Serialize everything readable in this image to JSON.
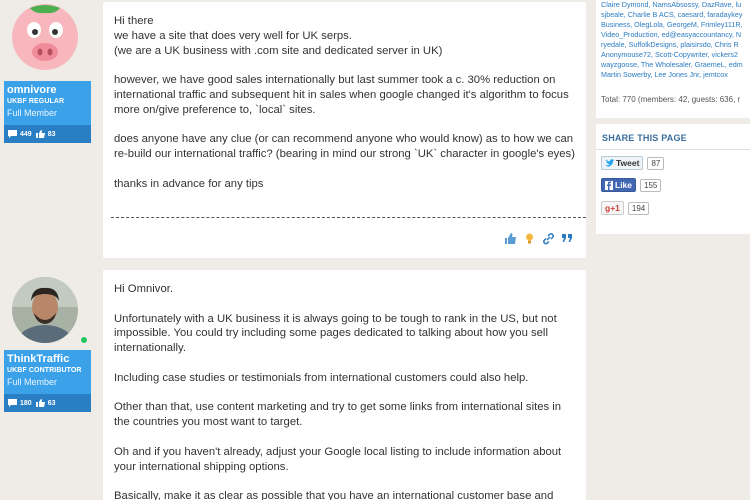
{
  "posts": [
    {
      "username": "omnivore",
      "user_title": "UKBF REGULAR",
      "user_group": "Full Member",
      "messages_count": "449",
      "likes_count": "83",
      "paragraphs": [
        "Hi there\nwe have a site that does very well for UK serps.\n(we are a UK business with .com site and dedicated server in UK)",
        "however, we have good sales internationally but last summer took a c. 30% reduction on international traffic and subsequent hit in sales when google changed it's algorithm to focus more on/give preference to, `local` sites.",
        "does anyone have any clue (or can recommend anyone who would know) as to how we can re-build our international traffic? (bearing in mind our strong `UK` character in google's eyes)",
        "thanks in advance for any tips"
      ]
    },
    {
      "username": "ThinkTraffic",
      "user_title": "UKBF CONTRIBUTOR",
      "user_group": "Full Member",
      "messages_count": "180",
      "likes_count": "63",
      "paragraphs": [
        "Hi Omnivor.",
        "Unfortunately with a UK business it is always going to be tough to rank in the US, but not impossible. You could try including some pages dedicated to talking about how you sell internationally.",
        "Including case studies or testimonials from international customers could also help.",
        "Other than that, use content marketing and try to get some links from international sites in the countries you most want to target.",
        "Oh and if you haven't already, adjust your Google local listing to include information about your international shipping options.",
        "Basically, make it as clear as possible that you have an international customer base and"
      ]
    }
  ],
  "sidebar": {
    "online_names": [
      "Claire Dymond, NamsAbsossy, DazRave, lu",
      "sjbeale, Charlie B ACS, caesard, faradaykey",
      "Business, OlegLola, GeorgeM, Frimley111R,",
      "Video_Production, ed@easyaccountancy, N",
      "ryedale, SuffolkDesigns, plaisirsdo, Chris R",
      "Anonymouse72, Scott-Copywriter, vickers2",
      "wayzgoose, The Wholesaler, GraemeL, edm",
      "Martin Sowerby, Lee Jones Jnr, jemtcox"
    ],
    "online_total": "Total: 770 (members: 42, guests: 636, r",
    "share_title": "SHARE THIS PAGE",
    "tweet_label": "Tweet",
    "tweet_count": "87",
    "like_label": "Like",
    "like_count": "155",
    "gplus_label": "g+1",
    "gplus_count": "194"
  },
  "colors": {
    "page_bg": "#efebe7",
    "user_card": "#3ba2ea",
    "user_stats": "#2a7ec4",
    "link": "#2b7bc2"
  },
  "icons": [
    "messages-icon",
    "likes-icon",
    "thumbs-up-icon",
    "bulb-icon",
    "link-icon",
    "quote-icon",
    "twitter-icon",
    "facebook-icon"
  ]
}
